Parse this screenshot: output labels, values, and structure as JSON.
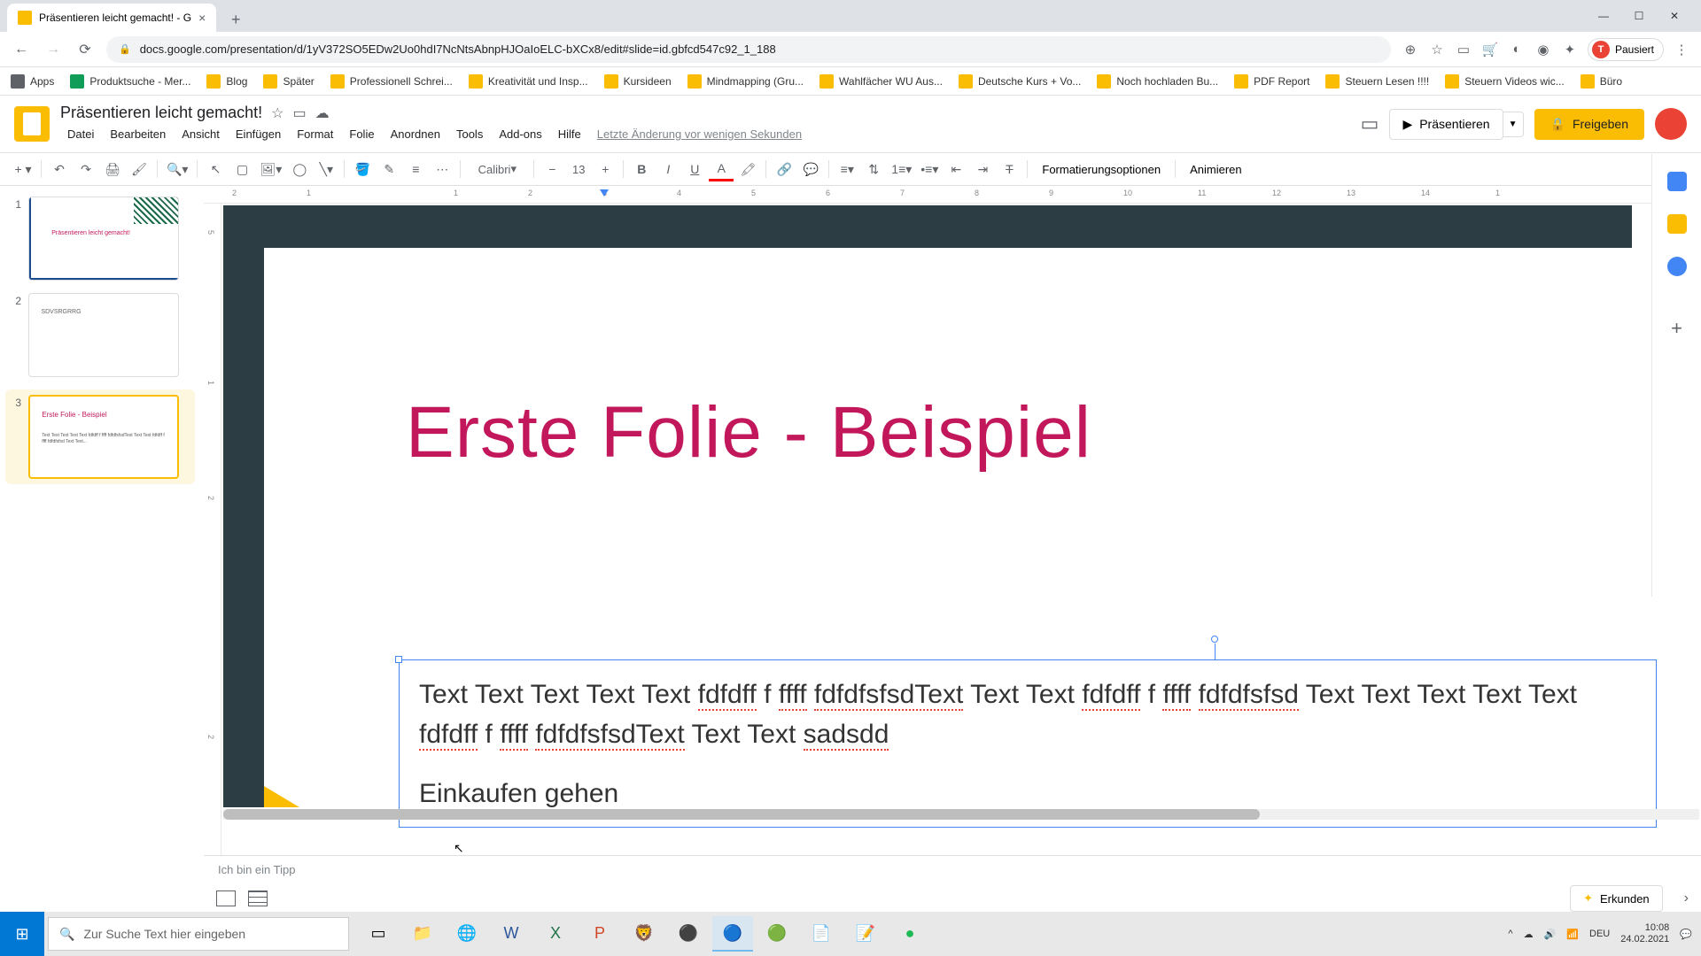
{
  "browser": {
    "tab_title": "Präsentieren leicht gemacht! - G",
    "url": "docs.google.com/presentation/d/1yV372SO5EDw2Uo0hdI7NcNtsAbnpHJOaIoELC-bXCx8/edit#slide=id.gbfcd547c92_1_188",
    "profile_status": "Pausiert",
    "bookmarks": [
      "Apps",
      "Produktsuche - Mer...",
      "Blog",
      "Später",
      "Professionell Schrei...",
      "Kreativität und Insp...",
      "Kursideen",
      "Mindmapping  (Gru...",
      "Wahlfächer WU Aus...",
      "Deutsche Kurs + Vo...",
      "Noch hochladen Bu...",
      "PDF Report",
      "Steuern Lesen !!!!",
      "Steuern Videos wic...",
      "Büro"
    ]
  },
  "doc": {
    "title": "Präsentieren leicht gemacht!",
    "menus": [
      "Datei",
      "Bearbeiten",
      "Ansicht",
      "Einfügen",
      "Format",
      "Folie",
      "Anordnen",
      "Tools",
      "Add-ons",
      "Hilfe"
    ],
    "last_edit": "Letzte Änderung vor wenigen Sekunden",
    "present": "Präsentieren",
    "share": "Freigeben"
  },
  "toolbar": {
    "font": "Calibri",
    "font_size": "13",
    "format_options": "Formatierungsoptionen",
    "animate": "Animieren"
  },
  "ruler_h": [
    "2",
    "1",
    "",
    "1",
    "2",
    "3",
    "4",
    "5",
    "6",
    "7",
    "8",
    "9",
    "10",
    "11",
    "12",
    "13",
    "14",
    "1"
  ],
  "ruler_v": [
    "5",
    "",
    "1",
    "2",
    "",
    "2"
  ],
  "thumbs": {
    "t1": {
      "num": "1",
      "title": "Präsentieren leicht gemacht!"
    },
    "t2": {
      "num": "2",
      "title": "SDVSRGRRG"
    },
    "t3": {
      "num": "3",
      "title": "Erste Folie - Beispiel",
      "body": "Text Text Text Text Text fdfdff f ffff fdfdfsfsdText Text Text fdfdff f ffff fdfdfsfsd Text Text..."
    }
  },
  "slide": {
    "title": "Erste Folie - Beispiel",
    "body1_a": "Text Text Text Text Text ",
    "body1_sp1": "fdfdff",
    "body1_b": " f ",
    "body1_sp2": "ffff",
    "body1_c": " ",
    "body1_sp3": "fdfdfsfsdText",
    "body1_d": " Text Text ",
    "body1_sp4": "fdfdff",
    "body1_e": " f ",
    "body1_sp5": "ffff",
    "body1_f": " ",
    "body1_sp6": "fdfdfsfsd",
    "body1_g": " Text Text Text Text Text ",
    "body1_sp7": "fdfdff",
    "body1_h": " f ",
    "body1_sp8": "ffff",
    "body1_i": " ",
    "body1_sp9": "fdfdfsfsdText",
    "body1_j": " Text Text ",
    "body1_sp10": "sadsdd",
    "body2": "Einkaufen gehen"
  },
  "notes": "Ich bin ein Tipp",
  "explore": "Erkunden",
  "taskbar": {
    "search_placeholder": "Zur Suche Text hier eingeben",
    "lang": "DEU",
    "time": "10:08",
    "date": "24.02.2021"
  }
}
